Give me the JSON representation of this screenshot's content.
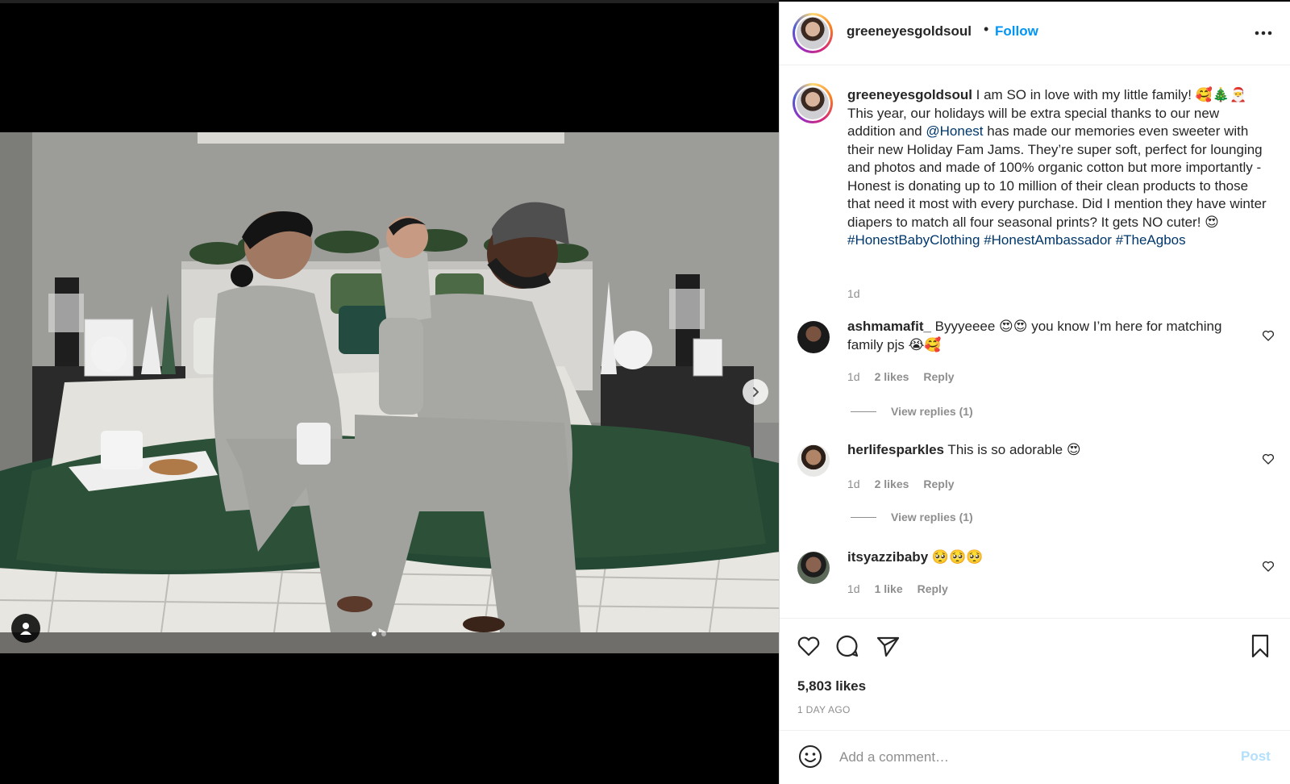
{
  "post": {
    "author": "greeneyesgoldsoul",
    "follow_label": "Follow",
    "separator": "•",
    "photo_alt": "Family in matching holiday pajamas on a bed",
    "carousel": {
      "slides": 2,
      "active": 0
    }
  },
  "caption": {
    "username": "greeneyesgoldsoul",
    "text_1": " I am SO in love with my little family! 🥰🎄🎅 This year, our holidays will be extra special thanks to our new addition and ",
    "mention": "@Honest",
    "text_2": " has made our memories even sweeter with their new Holiday Fam Jams. They’re super soft, perfect for lounging and photos and made of 100% organic cotton but more importantly - Honest is donating up to 10 million of their clean products to those that need it most with every purchase. Did I mention they have winter diapers to match all four seasonal prints? It gets NO cuter! 😍 ",
    "hashtag_1": "#HonestBabyClothing",
    "hashtag_2": "#HonestAmbassador",
    "hashtag_3": "#TheAgbos",
    "time": "1d"
  },
  "comments": [
    {
      "username": "ashmamafit_",
      "text": " Byyyeeee 😍😍 you know I’m here for matching family pjs 😭🥰",
      "time": "1d",
      "likes": "2 likes",
      "reply": "Reply",
      "view_replies": "View replies (1)"
    },
    {
      "username": "herlifesparkles",
      "text": " This is so adorable 😍",
      "time": "1d",
      "likes": "2 likes",
      "reply": "Reply",
      "view_replies": "View replies (1)"
    },
    {
      "username": "itsyazzibaby",
      "text": " 🥺🥺🥺",
      "time": "1d",
      "likes": "1 like",
      "reply": "Reply"
    }
  ],
  "engagement": {
    "likes": "5,803 likes",
    "posted": "1 DAY AGO"
  },
  "composer": {
    "placeholder": "Add a comment…",
    "post_label": "Post"
  },
  "icons": {
    "like": "heart-icon",
    "comment": "comment-bubble-icon",
    "share": "paper-plane-icon",
    "save": "bookmark-icon",
    "emoji": "smiley-icon",
    "more": "ellipsis-icon",
    "next": "chevron-right-icon",
    "tag": "user-tag-icon"
  },
  "colors": {
    "link_blue": "#0095f6",
    "mention_blue": "#00376b",
    "muted_text": "#8e8e8e",
    "post_disabled": "#b2dffc"
  }
}
